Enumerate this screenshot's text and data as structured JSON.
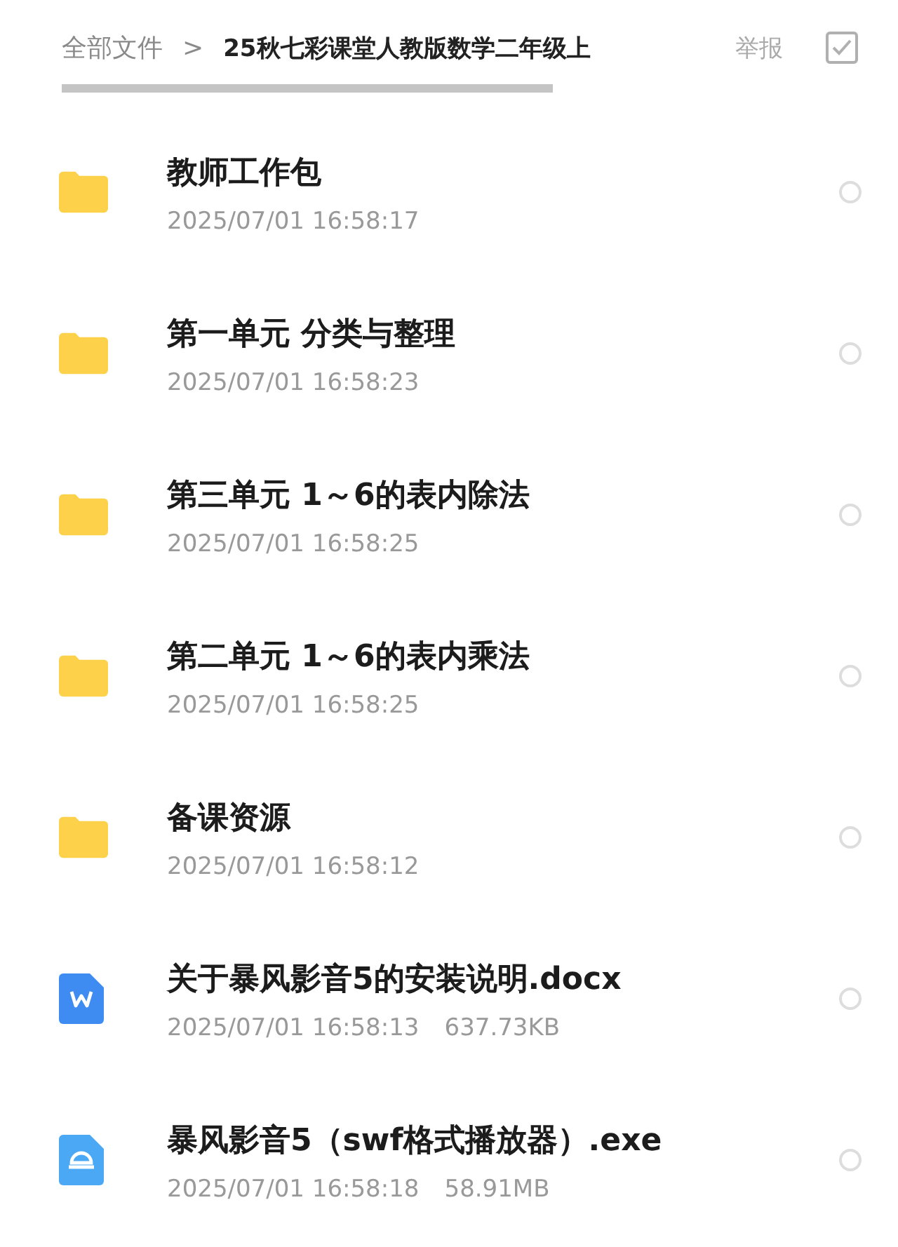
{
  "breadcrumb": {
    "root": "全部文件",
    "separator": ">",
    "current": "25秋七彩课堂人教版数学二年级上"
  },
  "report": "举报",
  "files": [
    {
      "kind": "folder",
      "name": "教师工作包",
      "date": "2025/07/01 16:58:17",
      "selected": false
    },
    {
      "kind": "folder",
      "name": "第一单元 分类与整理",
      "date": "2025/07/01 16:58:23",
      "selected": false
    },
    {
      "kind": "folder",
      "name": "第三单元 1～6的表内除法",
      "date": "2025/07/01 16:58:25",
      "selected": false
    },
    {
      "kind": "folder",
      "name": "第二单元 1～6的表内乘法",
      "date": "2025/07/01 16:58:25",
      "selected": false
    },
    {
      "kind": "folder",
      "name": "备课资源",
      "date": "2025/07/01 16:58:12",
      "selected": false
    },
    {
      "kind": "doc",
      "name": "关于暴风影音5的安装说明.docx",
      "date": "2025/07/01 16:58:13",
      "size": "637.73KB",
      "selected": false
    },
    {
      "kind": "exe",
      "name": "暴风影音5（swf格式播放器）.exe",
      "date": "2025/07/01 16:58:18",
      "size": "58.91MB",
      "selected": false
    }
  ]
}
